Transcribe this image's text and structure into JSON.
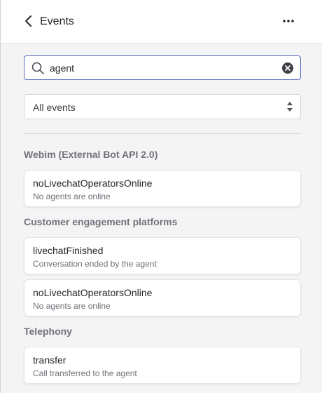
{
  "header": {
    "title": "Events",
    "back_icon": "chevron-left-icon",
    "more_icon": "more-horizontal-icon"
  },
  "search": {
    "value": "agent",
    "placeholder": "",
    "search_icon": "search-icon",
    "clear_icon": "clear-icon"
  },
  "filter": {
    "selected": "All events"
  },
  "sections": [
    {
      "heading": "Webim (External Bot API 2.0)",
      "events": [
        {
          "name": "noLivechatOperatorsOnline",
          "description": "No agents are online"
        }
      ]
    },
    {
      "heading": "Customer engagement platforms",
      "events": [
        {
          "name": "livechatFinished",
          "description": "Conversation ended by the agent"
        },
        {
          "name": "noLivechatOperatorsOnline",
          "description": "No agents are online"
        }
      ]
    },
    {
      "heading": "Telephony",
      "events": [
        {
          "name": "transfer",
          "description": "Call transferred to the agent"
        }
      ]
    }
  ],
  "colors": {
    "accent": "#5b6bbf",
    "background": "#f4f4f5",
    "card": "#ffffff",
    "heading_text": "#71717a"
  }
}
